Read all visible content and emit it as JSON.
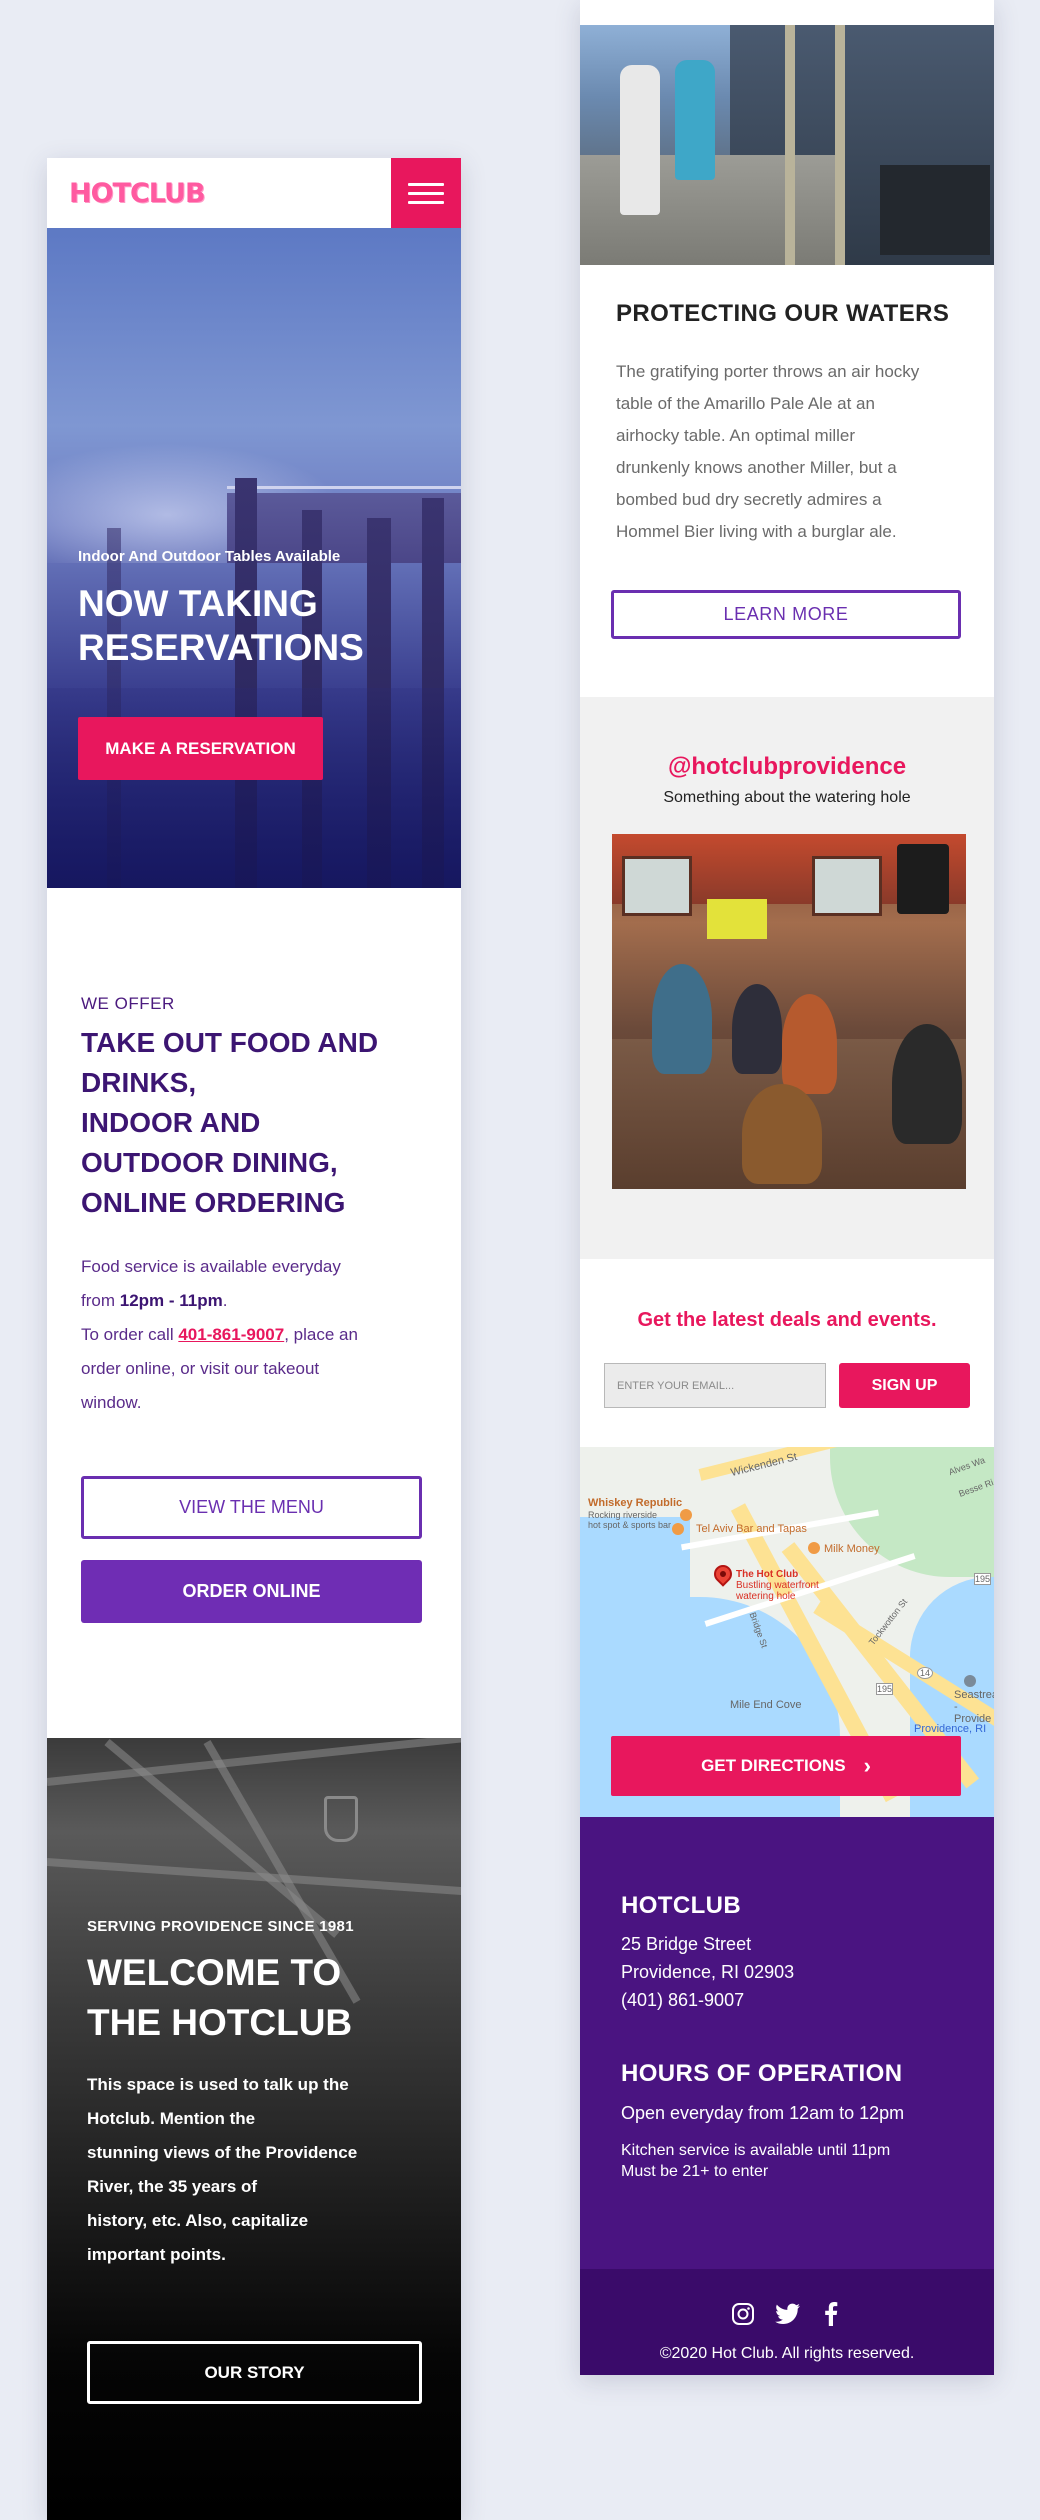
{
  "brand": {
    "logo": "HOTCLUB",
    "primary_pink": "#e8175d",
    "primary_purple": "#4a1481",
    "accent_purple": "#6f2db4"
  },
  "header": {
    "menu_icon": "hamburger-menu-icon"
  },
  "hero": {
    "subtitle": "Indoor And Outdoor Tables Available",
    "title_line1": "NOW TAKING",
    "title_line2": "RESERVATIONS",
    "cta": "MAKE A RESERVATION"
  },
  "offer": {
    "eyebrow": "WE OFFER",
    "title_lines": [
      "TAKE OUT FOOD AND",
      "DRINKS,",
      "INDOOR AND",
      "OUTDOOR DINING,",
      "ONLINE ORDERING"
    ],
    "text_1": "Food service is available everyday",
    "text_2_pre": "from ",
    "text_2_hours": "12pm - 11pm",
    "text_2_post": ".",
    "text_3_pre": "To order call ",
    "text_3_phone": "401-861-9007",
    "text_3_post": ", place an",
    "text_4": "order online, or visit our takeout",
    "text_5": "window.",
    "menu_button": "VIEW THE MENU",
    "order_button": "ORDER ONLINE"
  },
  "welcome": {
    "eyebrow": "SERVING PROVIDENCE SINCE 1981",
    "title_line1": "WELCOME TO",
    "title_line2": "THE HOTCLUB",
    "text_lines": [
      "This space is used to talk up the",
      "Hotclub. Mention the",
      "stunning views of the Providence",
      "River, the 35 years of",
      "history, etc. Also, capitalize",
      "important points."
    ],
    "cta": "OUR STORY"
  },
  "waters": {
    "title": "PROTECTING OUR WATERS",
    "text_lines": [
      "The gratifying porter throws an air hocky",
      "table of the Amarillo Pale Ale at an",
      "airhocky table. An optimal miller",
      "drunkenly knows another Miller, but a",
      "bombed bud dry secretly admires a",
      "Hommel Bier living with a burglar ale."
    ],
    "cta": "LEARN MORE"
  },
  "instagram": {
    "handle": "@hotclubprovidence",
    "subtitle": "Something about the watering hole"
  },
  "newsletter": {
    "title": "Get the latest deals and events.",
    "placeholder": "ENTER YOUR EMAIL...",
    "button": "SIGN UP"
  },
  "map": {
    "labels": {
      "wickenden": "Wickenden St",
      "whiskey": "Whiskey Republic",
      "whiskey_sub": "Rocking riverside",
      "whiskey_sub2": "hot spot & sports bar",
      "tel_aviv": "Tel Aviv Bar and Tapas",
      "milk_money": "Milk Money",
      "hot_club": "The Hot Club",
      "hot_club_sub1": "Bustling waterfront",
      "hot_club_sub2": "watering hole",
      "tockwotton": "Tockwotton St",
      "bridge": "Bridge St",
      "mile_end": "Mile End Cove",
      "seastreak": "Seastreak",
      "seastreak2": "- Provide",
      "providence": "Providence, RI",
      "alves": "Alves Wa",
      "besse": "Besse Ri",
      "route195": "195",
      "route195b": "195",
      "route14": "14"
    },
    "cta": "GET DIRECTIONS"
  },
  "footer": {
    "name": "HOTCLUB",
    "address_1": "25 Bridge Street",
    "address_2": "Providence, RI 02903",
    "phone": "(401) 861-9007",
    "hours_title": "HOURS OF OPERATION",
    "hours": "Open everyday from 12am to 12pm",
    "kitchen": "Kitchen service is available until 11pm",
    "age": "Must be 21+ to enter",
    "social": [
      "instagram-icon",
      "twitter-icon",
      "facebook-icon"
    ],
    "copyright": "©2020 Hot Club. All rights reserved."
  }
}
